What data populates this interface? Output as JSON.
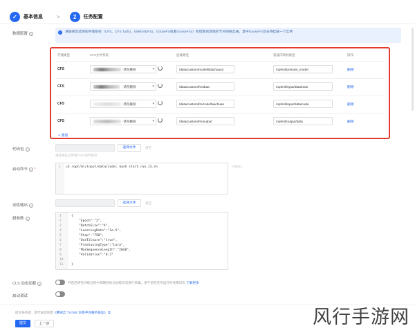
{
  "stepper": {
    "step1_label": "基本信息",
    "step2_number": "2",
    "step2_label": "任务配置",
    "separator": ">"
  },
  "labels": {
    "data_config": "数据配置",
    "code_package": "代码包",
    "start_command": "启动命令",
    "output_path": "训练输出",
    "hyperparams": "超参数",
    "dynamic_switch": "CLS 动态加载",
    "debug_mode": "启动调试"
  },
  "banner": {
    "text": "请确保您选择的存储系统（CFS、CFS Turbo、EMR(HDFS)、GooseFS或者GooseFSx）和镜像资源组的节点网络互通，其中GooseFS仅支持挂载一个实例"
  },
  "table": {
    "headers": [
      "存储类型",
      "CFS文件系统",
      "挂载路径",
      "容器内映射路径",
      "操作"
    ],
    "rows": [
      {
        "type": "CFS",
        "fs_suffix": "-请勿删除",
        "mount": "/data/custom/model/Baichuan2",
        "local": "/opt/ml/pretrain_model",
        "action": "删除"
      },
      {
        "type": "CFS",
        "fs_suffix": "-请勿删除",
        "mount": "/data/custom/fm/data",
        "local": "/opt/ml/input/data/train",
        "action": "删除"
      },
      {
        "type": "CFS",
        "fs_suffix": "-请勿删除",
        "mount": "/data/custom/fm/code/baichuan",
        "local": "/opt/ml/input/data/code",
        "action": "删除"
      },
      {
        "type": "CFS",
        "fs_suffix": "-请勿删除",
        "mount": "/data/custom/fm/output",
        "local": "/opt/ml/output/data",
        "action": "删除"
      }
    ],
    "add_label": "+ 添加"
  },
  "code_package": {
    "select_file": "选择文件",
    "clear": "清空",
    "hint": "请选择已上传到COS 的代码包"
  },
  "start_command": {
    "line_no": "1",
    "code": "cd /opt/ml/input/data/code; bash start_run_13.sh",
    "counter": "0/8192"
  },
  "output": {
    "select_file": "选择文件",
    "clear": "清空"
  },
  "hyperparams": {
    "lines": [
      {
        "n": "1",
        "text": "{"
      },
      {
        "n": "2",
        "text": "    \"Epoch\":\"2\","
      },
      {
        "n": "3",
        "text": "    \"BatchSize\":\"4\","
      },
      {
        "n": "4",
        "text": "    \"LearningRate\":\"1e-5\","
      },
      {
        "n": "5",
        "text": "    \"Step\":\"750\","
      },
      {
        "n": "6",
        "text": "    \"UseTilearn\":\"true\","
      },
      {
        "n": "7",
        "text": "    \"FinetuningType\":\"Lora\","
      },
      {
        "n": "8",
        "text": "    \"MaxSequenceLength\":\"2048\","
      },
      {
        "n": "9",
        "text": "    \"Validation\":\"0.2\""
      },
      {
        "n": "10",
        "text": ""
      },
      {
        "n": "11",
        "text": "}"
      }
    ]
  },
  "dynamic_switch": {
    "note": "开启后将在训练过程中周期性地对训练日志进行采集，便于您在任务运行时查看日志",
    "link": "了解更多"
  },
  "footer": {
    "note": "提交任务后，即代表您同意",
    "link": "《腾讯云 TI-ONE 训练平台服务协议》",
    "primary": "提交",
    "secondary": "上一步"
  },
  "watermark": "风行手游网",
  "colors": {
    "primary": "#2468f2",
    "highlight_border": "#e23b2e",
    "banner_bg": "#e8f1fd"
  }
}
